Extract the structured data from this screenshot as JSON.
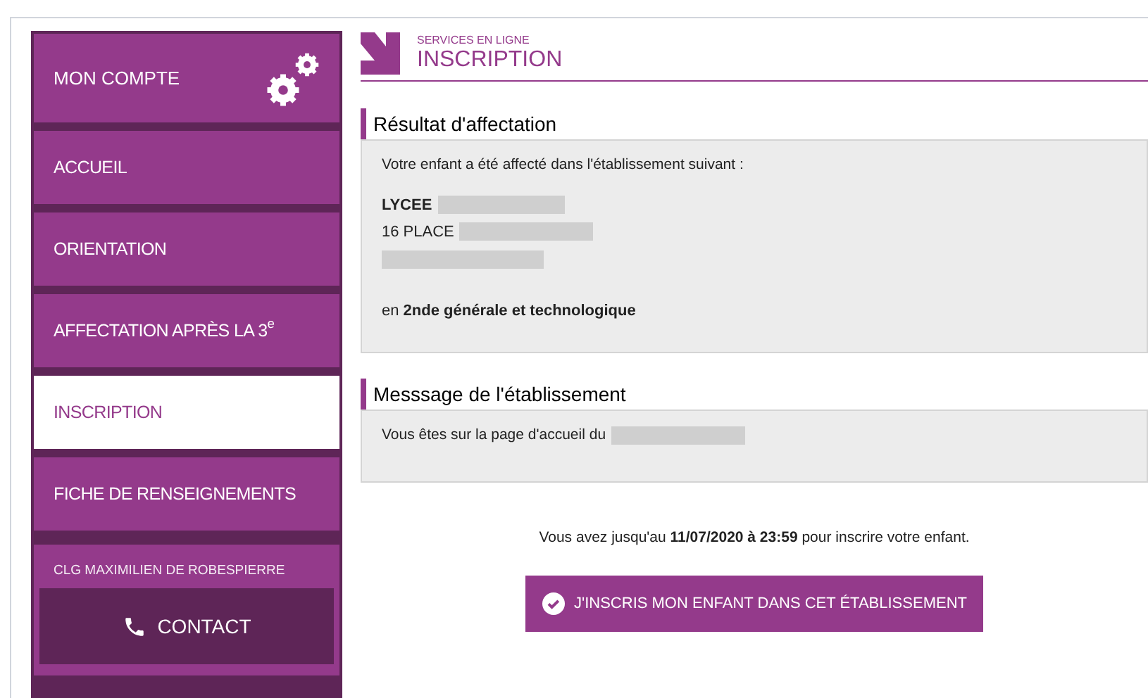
{
  "sidebar": {
    "account": {
      "label": "MON COMPTE"
    },
    "items": [
      {
        "label": "ACCUEIL",
        "selected": false
      },
      {
        "label": "ORIENTATION",
        "selected": false
      },
      {
        "label": "AFFECTATION APRÈS LA 3$^{e}$",
        "selected": false
      },
      {
        "label": "INSCRIPTION",
        "selected": true
      },
      {
        "label": "FICHE DE RENSEIGNEMENTS",
        "selected": false
      }
    ],
    "school": "CLG MAXIMILIEN DE ROBESPIERRE",
    "contact_button": "CONTACT"
  },
  "header": {
    "kicker": "SERVICES EN LIGNE",
    "title": "INSCRIPTION"
  },
  "sections": [
    {
      "title": "Résultat d'affectation",
      "lines": [
        {
          "kind": "text",
          "text": "Votre enfant a été affecté dans l'établissement suivant :"
        },
        {
          "kind": "address",
          "text": "LYCEE",
          "redacted": true
        },
        {
          "kind": "address",
          "text": "16 PLACE",
          "redacted": true
        },
        {
          "kind": "redacted"
        },
        {
          "kind": "gap"
        },
        {
          "kind": "text",
          "text": "en **2nde générale et technologique**"
        }
      ]
    },
    {
      "title": "Messsage de l'établissement",
      "lines": [
        {
          "kind": "text",
          "text": "Vous êtes sur la page d'accueil du",
          "redacted": true
        }
      ]
    }
  ],
  "deadline": "Vous avez jusqu'au **11/07/2020 à 23:59** pour inscrire votre enfant.",
  "enroll_button": "J'INSCRIS MON ENFANT DANS CET ÉTABLISSEMENT"
}
